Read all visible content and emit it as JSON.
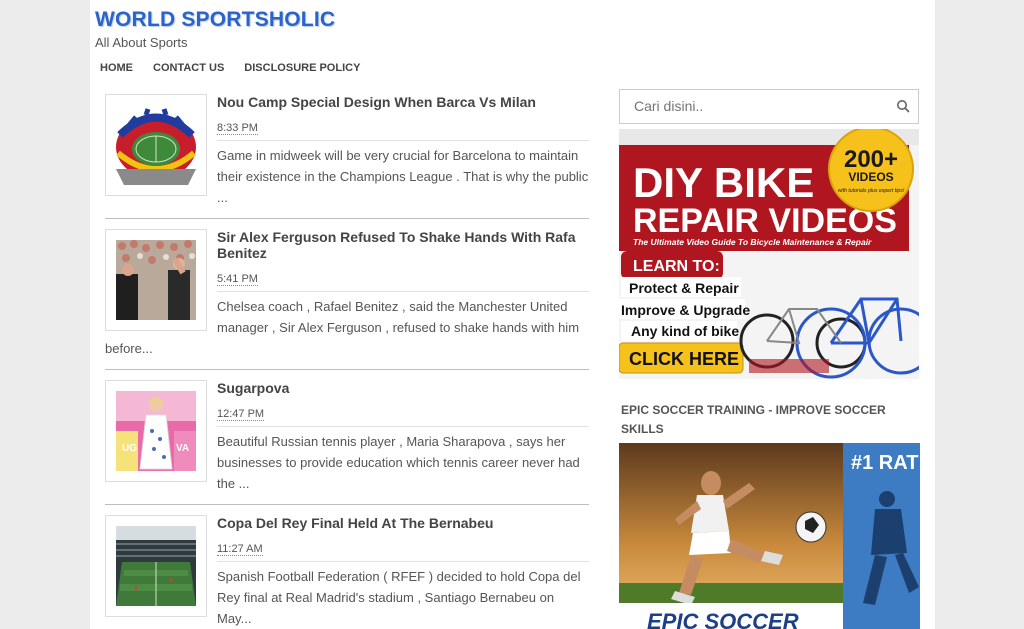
{
  "site": {
    "title": "WORLD SPORTSHOLIC",
    "description": "All About Sports"
  },
  "nav": [
    "HOME",
    "CONTACT US",
    "DISCLOSURE POLICY"
  ],
  "posts": [
    {
      "title": "Nou Camp Special Design When Barca Vs Milan",
      "time": "8:33 PM",
      "snippet": "Game in midweek will be very crucial for Barcelona to maintain their existence in the Champions League . That is why the public ..."
    },
    {
      "title": "Sir Alex Ferguson Refused To Shake Hands With Rafa Benitez",
      "time": "5:41 PM",
      "snippet": "Chelsea coach , Rafael Benitez , said the Manchester United manager , Sir Alex Ferguson , refused to shake hands with him before..."
    },
    {
      "title": "Sugarpova",
      "time": "12:47 PM",
      "snippet": "Beautiful Russian tennis player , Maria Sharapova , says her businesses to provide education which tennis career never had the ..."
    },
    {
      "title": "Copa Del Rey Final Held At The Bernabeu",
      "time": "11:27 AM",
      "snippet": "Spanish Football Federation ( RFEF ) decided to hold Copa del Rey final at Real Madrid's stadium , Santiago Bernabeu on May..."
    }
  ],
  "sidebar": {
    "search_placeholder": "Cari disini..",
    "ad": {
      "line1": "DIY BIKE",
      "line2": "REPAIR VIDEOS",
      "tagline": "The Ultimate Video Guide To Bicycle Maintenance & Repair",
      "badge_big": "200+",
      "badge_mid": "VIDEOS",
      "badge_small": "with tutorials plus expert tips!",
      "learn": "LEARN TO:",
      "items": [
        "Protect & Repair",
        "Improve & Upgrade",
        "Any kind of bike"
      ],
      "cta": "CLICK HERE"
    },
    "widget_title": "EPIC SOCCER TRAINING - IMPROVE SOCCER SKILLS",
    "soccer": {
      "rank": "#1 RAT",
      "brand": "EPIC SOCCER"
    }
  },
  "colors": {
    "title_blue": "#2a63c9",
    "ad_red": "#b0161f",
    "badge_gold": "#f5c11a"
  }
}
